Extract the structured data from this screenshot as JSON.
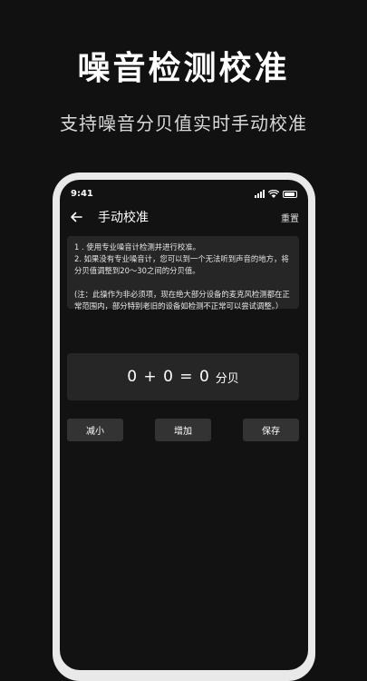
{
  "hero": {
    "title": "噪音检测校准",
    "subtitle": "支持噪音分贝值实时手动校准"
  },
  "status_bar": {
    "time": "9:41"
  },
  "nav": {
    "title": "手动校准",
    "reset_label": "重置"
  },
  "info": {
    "line1": "1 . 使用专业噪音计检测并进行校准。",
    "line2": "2. 如果没有专业噪音计，您可以到一个无法听到声音的地方，将分贝值调整到20～30之间的分贝值。",
    "note": "(注：此操作为非必须项，现在绝大部分设备的麦克风检测都在正常范围内，部分特别老旧的设备如检测不正常可以尝试调整。）"
  },
  "calibration": {
    "formula": "0 + 0 = 0",
    "unit": "分贝"
  },
  "buttons": {
    "decrease": "减小",
    "increase": "增加",
    "save": "保存"
  },
  "colors": {
    "background": "#111111",
    "card": "#262626",
    "button": "#333333",
    "phone_frame": "#e9e9e9"
  }
}
